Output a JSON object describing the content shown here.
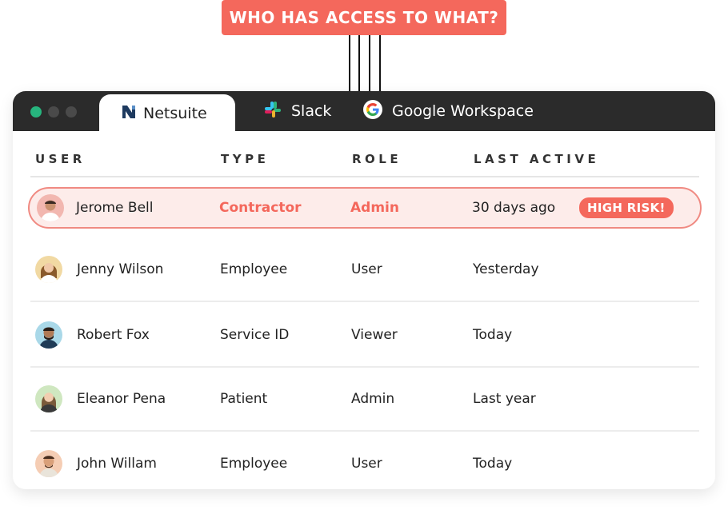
{
  "callout": {
    "text": "WHO HAS ACCESS TO WHAT?"
  },
  "tabs": [
    {
      "label": "Netsuite",
      "icon": "netsuite-icon",
      "active": true
    },
    {
      "label": "Slack",
      "icon": "slack-icon",
      "active": false
    },
    {
      "label": "Google Workspace",
      "icon": "google-icon",
      "active": false
    }
  ],
  "table": {
    "headers": {
      "user": "USER",
      "type": "TYPE",
      "role": "ROLE",
      "last_active": "LAST ACTIVE"
    },
    "rows": [
      {
        "name": "Jerome Bell",
        "type": "Contractor",
        "role": "Admin",
        "last_active": "30 days ago",
        "badge": "HIGH RISK!",
        "avatar_color": "#f2b7b0"
      },
      {
        "name": "Jenny Wilson",
        "type": "Employee",
        "role": "User",
        "last_active": "Yesterday",
        "avatar_color": "#f1d9a3"
      },
      {
        "name": "Robert Fox",
        "type": "Service ID",
        "role": "Viewer",
        "last_active": "Today",
        "avatar_color": "#a9d8e8"
      },
      {
        "name": "Eleanor Pena",
        "type": "Patient",
        "role": "Admin",
        "last_active": "Last year",
        "avatar_color": "#cfe7c0"
      },
      {
        "name": "John Willam",
        "type": "Employee",
        "role": "User",
        "last_active": "Today",
        "avatar_color": "#f5cdb4"
      }
    ]
  },
  "colors": {
    "accent": "#f4685c",
    "titlebar": "#2b2b2b",
    "window_dot_green": "#27b57e",
    "risk_bg": "#fdecea"
  }
}
